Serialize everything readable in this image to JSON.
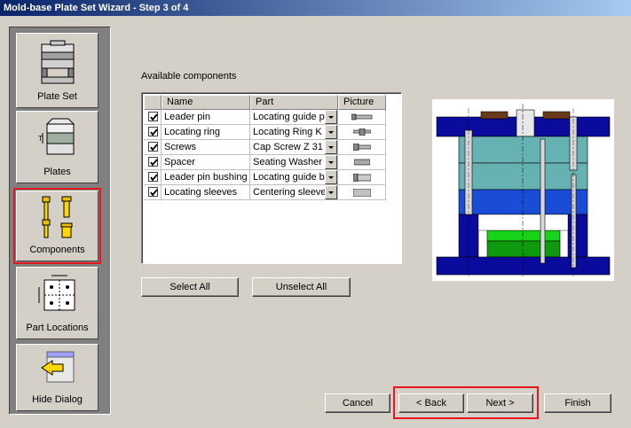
{
  "window": {
    "title": "Mold-base Plate Set Wizard - Step 3 of 4"
  },
  "sidebar": {
    "items": [
      {
        "label": "Plate Set",
        "icon": "plate-set-icon"
      },
      {
        "label": "Plates",
        "icon": "plates-icon"
      },
      {
        "label": "Components",
        "icon": "components-icon",
        "active": true
      },
      {
        "label": "Part Locations",
        "icon": "part-locations-icon"
      },
      {
        "label": "Hide Dialog",
        "icon": "hide-dialog-icon"
      }
    ]
  },
  "components": {
    "label": "Available components",
    "columns": [
      "Name",
      "Part",
      "Picture"
    ],
    "rows": [
      {
        "checked": true,
        "name": "Leader pin",
        "part": "Locating guide pi..",
        "picture": "leader-pin-thumbnail"
      },
      {
        "checked": true,
        "name": "Locating ring",
        "part": "Locating Ring K ..",
        "picture": "locating-ring-thumbnail"
      },
      {
        "checked": true,
        "name": "Screws",
        "part": "Cap Screw Z 31",
        "picture": "screw-thumbnail"
      },
      {
        "checked": true,
        "name": "Spacer",
        "part": "Seating Washer ..",
        "picture": "spacer-thumbnail"
      },
      {
        "checked": true,
        "name": "Leader pin bushing",
        "part": "Locating guide b..",
        "picture": "bushing-thumbnail"
      },
      {
        "checked": true,
        "name": "Locating sleeves",
        "part": "Centering sleeve..",
        "picture": "sleeve-thumbnail"
      }
    ],
    "select_all": "Select All",
    "unselect_all": "Unselect All"
  },
  "footer": {
    "cancel": "Cancel",
    "back": "< Back",
    "next": "Next >",
    "finish": "Finish"
  },
  "colors": {
    "title_start": "#0a246a",
    "title_end": "#a6caf0",
    "highlight": "#e8151b",
    "mold_teal": "#66b2b2",
    "mold_blue": "#1a4dd6",
    "mold_dark_blue": "#0a0a9c",
    "mold_green": "#18d418"
  }
}
